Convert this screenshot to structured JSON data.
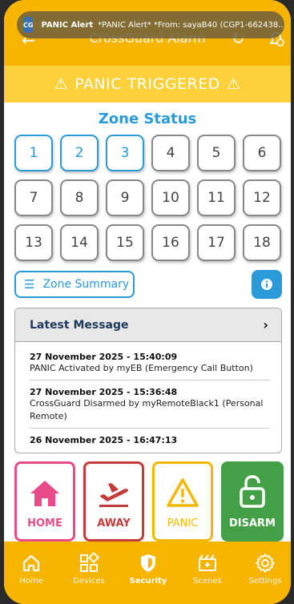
{
  "header": {
    "title": "CrossGuard Alarm"
  },
  "notification": {
    "app_icon_text": "CG",
    "title": "PANIC Alert",
    "body": "*PANIC Alert* *From: sayaB40 (CGP1-662438..."
  },
  "banner": {
    "text": "PANIC TRIGGERED",
    "icon_left": "⚠",
    "icon_right": "⚠"
  },
  "zones": {
    "title": "Zone Status",
    "items": [
      "1",
      "2",
      "3",
      "4",
      "5",
      "6",
      "7",
      "8",
      "9",
      "10",
      "11",
      "12",
      "13",
      "14",
      "15",
      "16",
      "17",
      "18"
    ],
    "active": [
      "1",
      "2",
      "3"
    ]
  },
  "summary": {
    "label": "Zone Summary",
    "info_icon": "i"
  },
  "messages": {
    "title": "Latest Message",
    "items": [
      {
        "date": "27 November 2025 - 15:40:09",
        "text": "PANIC Activated by myEB (Emergency Call Button)"
      },
      {
        "date": "27 November 2025 - 15:36:48",
        "text": "CrossGuard Disarmed by myRemoteBlack1 (Personal Remote)"
      },
      {
        "date": "26 November 2025 - 16:47:13",
        "text": ""
      }
    ]
  },
  "actions": {
    "home": "HOME",
    "away": "AWAY",
    "panic": "PANIC",
    "disarm": "DISARM"
  },
  "tabs": {
    "home": "Home",
    "devices": "Devices",
    "security": "Security",
    "scenes": "Scenes",
    "settings": "Settings"
  },
  "colors": {
    "brand": "#f7b500",
    "accent": "#2a9ad8",
    "home": "#e84a8a",
    "away": "#c43b3b",
    "disarm": "#43a047"
  }
}
